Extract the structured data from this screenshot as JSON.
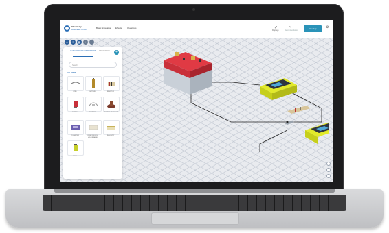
{
  "header": {
    "brand_line1": "Chemistry",
    "brand_line2": "Advanced Circuit",
    "nav": [
      "Basic Simulation",
      "Effects",
      "Questions"
    ],
    "action1_label": "Displays",
    "action2_label": "Recommendation",
    "cta_label": "Develop"
  },
  "toolbar": {
    "buttons": [
      "home-icon",
      "layers-icon",
      "grid-icon",
      "zoom-icon",
      "minus-icon"
    ]
  },
  "panel": {
    "tab_active": "BASIC CIRCUIT COMPONENTS",
    "tab_inactive": "RESOURCES",
    "search_placeholder": "Search",
    "section_title": "ALL ITEMS",
    "components": [
      {
        "label": "WIRE"
      },
      {
        "label": "BATTERY"
      },
      {
        "label": "RESISTOR"
      },
      {
        "label": "SWITCH"
      },
      {
        "label": "AMMETER"
      },
      {
        "label": "VARIABLE RESISTOR"
      },
      {
        "label": "VOLTMETER"
      },
      {
        "label": "RESISTOR BOX (ADJUSTABLE)"
      },
      {
        "label": "RHEOSTAT"
      },
      {
        "label": "BULB"
      }
    ]
  },
  "colors": {
    "accent": "#2a93b8",
    "brand": "#2b6fb6",
    "battery_red": "#c9303a",
    "meter_yellow": "#d9e21f"
  }
}
